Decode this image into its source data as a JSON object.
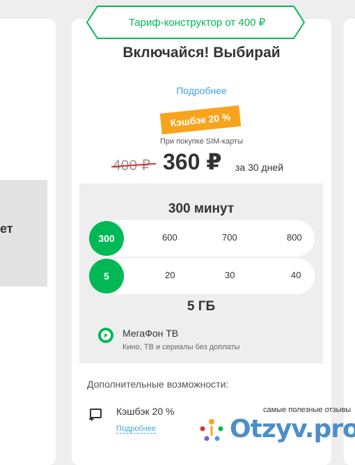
{
  "banner": {
    "text": "Тариф-конструктор от 400 ₽"
  },
  "left_card": {
    "partial_text": "ет"
  },
  "tariff": {
    "title": "Включайся! Выбирай",
    "more_link": "Подробнее",
    "cashback_badge": "Кэшбэк 20 %",
    "sim_note": "При покупке SIM-карты",
    "old_price": "400 ₽",
    "new_price": "360 ₽",
    "period": "за 30 дней"
  },
  "minutes": {
    "title": "300 минут",
    "selected": "300",
    "options": [
      "600",
      "700",
      "800"
    ]
  },
  "gigabytes": {
    "title": "5 ГБ",
    "selected": "5",
    "options": [
      "20",
      "30",
      "40"
    ]
  },
  "tv": {
    "title": "МегаФон ТВ",
    "subtitle": "Кино, ТВ и сериалы без доплаты"
  },
  "extras": {
    "title": "Дополнительные возможности:",
    "cashback_label": "Кэшбэк 20 %",
    "cashback_link": "Подробнее"
  },
  "watermark": {
    "caption": "самые полезные отзывы",
    "brand": "Otzyv.pro"
  },
  "colors": {
    "accent": "#00b956",
    "link": "#40a3e0",
    "badge": "#f7a41c",
    "strike": "#e02d2d"
  }
}
